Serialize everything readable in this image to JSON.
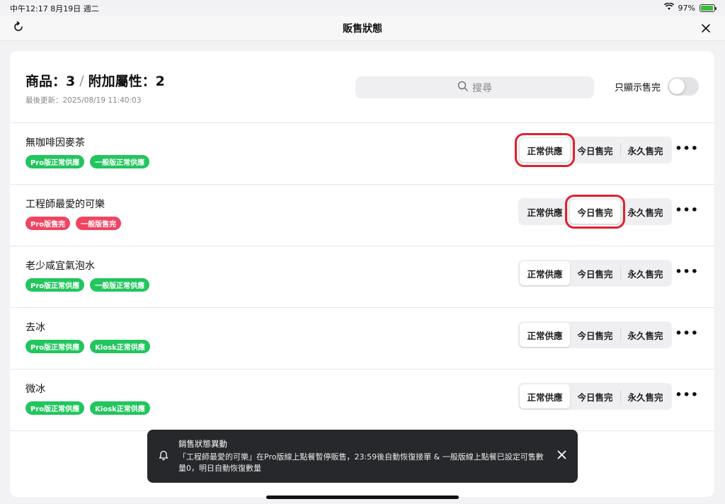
{
  "status": {
    "time_date": "中午12:17  8月19日 週二",
    "battery_pct": "97%",
    "battery_level": 0.97
  },
  "nav": {
    "title": "販售狀態"
  },
  "header": {
    "products_label": "商品：3",
    "separator": "/",
    "attributes_label": "附加屬性：2",
    "last_updated": "最後更新：2025/08/19 11:40:03",
    "search_placeholder": "搜尋",
    "toggle_label": "只顯示售完",
    "toggle_on": false
  },
  "segment_labels": [
    "正常供應",
    "今日售完",
    "永久售完"
  ],
  "items": [
    {
      "name": "無咖啡因麥茶",
      "badges": [
        {
          "text": "Pro版正常供應",
          "color": "#22c55e"
        },
        {
          "text": "一般版正常供應",
          "color": "#22c55e"
        }
      ],
      "active": 0,
      "highlighted": 0
    },
    {
      "name": "工程師最愛的可樂",
      "badges": [
        {
          "text": "Pro版售完",
          "color": "#ef4562"
        },
        {
          "text": "一般版售完",
          "color": "#ef4562"
        }
      ],
      "active": 1,
      "highlighted": 1
    },
    {
      "name": "老少咸宜氣泡水",
      "badges": [
        {
          "text": "Pro版正常供應",
          "color": "#22c55e"
        },
        {
          "text": "一般版正常供應",
          "color": "#22c55e"
        }
      ],
      "active": 0,
      "highlighted": -1
    },
    {
      "name": "去冰",
      "badges": [
        {
          "text": "Pro版正常供應",
          "color": "#22c55e"
        },
        {
          "text": "Kiosk正常供應",
          "color": "#22c55e"
        }
      ],
      "active": 0,
      "highlighted": -1
    },
    {
      "name": "微冰",
      "badges": [
        {
          "text": "Pro版正常供應",
          "color": "#22c55e"
        },
        {
          "text": "Kiosk正常供應",
          "color": "#22c55e"
        }
      ],
      "active": 0,
      "highlighted": -1
    }
  ],
  "more_label": "•••",
  "toast": {
    "title": "銷售狀態異動",
    "message": "「工程師最愛的可樂」在Pro版線上點餐暫停販售，23:59後自動恢復接單 & 一般版線上點餐已設定可售數量0，明日自動恢復數量"
  },
  "icons": {
    "refresh": "refresh-icon",
    "close": "close-icon",
    "search": "search-icon",
    "bell": "bell-icon",
    "wifi": "wifi-icon",
    "battery": "battery-icon"
  },
  "colors": {
    "highlight_border": "#e0202e",
    "green_badge": "#22c55e",
    "red_badge": "#ef4562",
    "toast_bg": "#26282b"
  }
}
